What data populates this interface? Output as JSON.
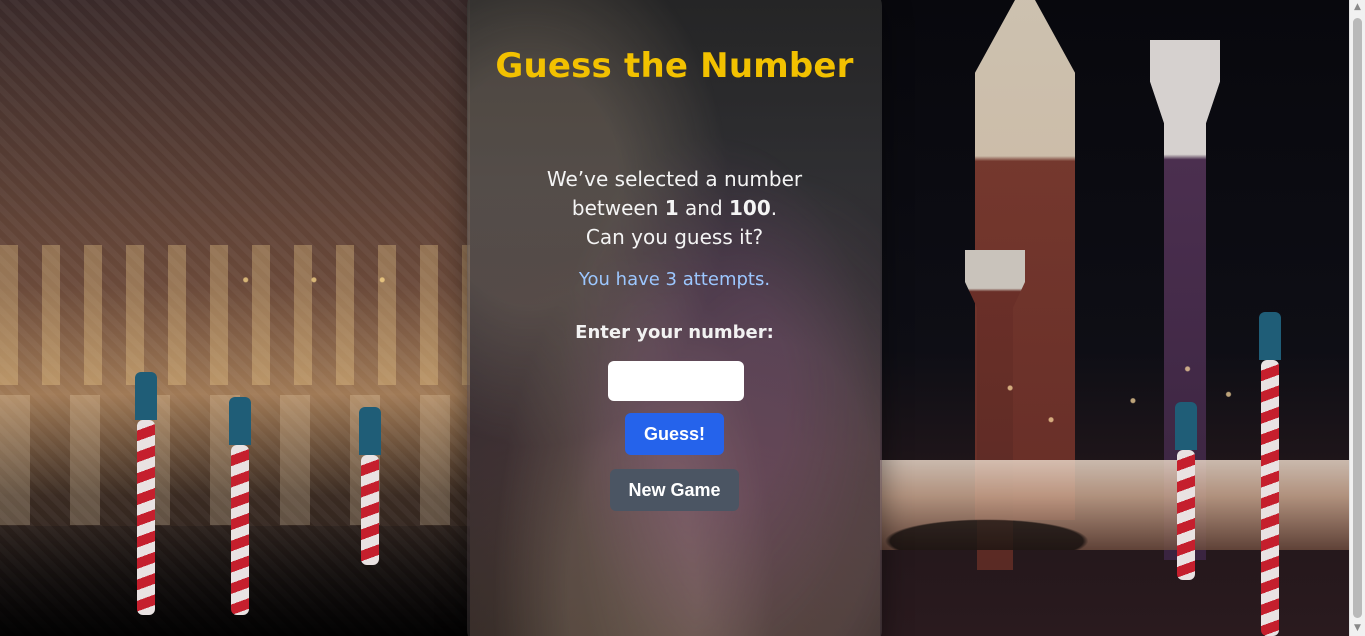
{
  "game": {
    "title": "Guess the Number",
    "intro": {
      "line1": "We’ve selected a number",
      "line2_prefix": "between ",
      "min": "1",
      "line2_middle": " and ",
      "max": "100",
      "line2_suffix": ".",
      "line3": "Can you guess it?"
    },
    "attempts_text": "You have 3 attempts.",
    "input_label": "Enter your number:",
    "input_value": "",
    "input_placeholder": "",
    "buttons": {
      "guess": "Guess!",
      "new_game": "New Game"
    }
  },
  "theme": {
    "title_color": "#f2c100",
    "attempts_color": "#9cc7ff",
    "primary_button": "#2563eb",
    "secondary_button": "#4b5563"
  },
  "icons": {
    "scroll_up": "scroll-up-arrow",
    "scroll_down": "scroll-down-arrow"
  }
}
